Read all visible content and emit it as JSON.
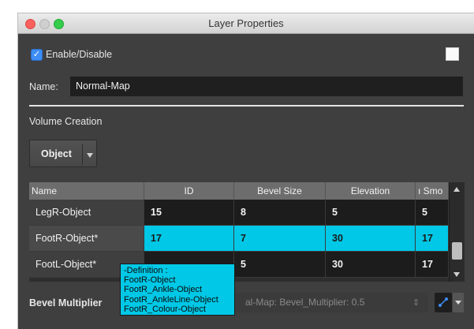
{
  "window": {
    "title": "Layer Properties"
  },
  "enable": {
    "label": "Enable/Disable",
    "checked": true
  },
  "name": {
    "label": "Name:",
    "value": "Normal-Map"
  },
  "volume": {
    "section_label": "Volume Creation",
    "dropdown_value": "Object"
  },
  "table": {
    "columns": [
      "Name",
      "ID",
      "Bevel Size",
      "Elevation",
      "ı Smo"
    ],
    "rows": [
      {
        "name": "LegR-Object",
        "id": "15",
        "bevel": "8",
        "elevation": "5",
        "smooth": "5"
      },
      {
        "name": "FootR-Object*",
        "id": "17",
        "bevel": "7",
        "elevation": "30",
        "smooth": "17"
      },
      {
        "name": "FootL-Object*",
        "id": "",
        "bevel": "5",
        "elevation": "30",
        "smooth": "17"
      }
    ]
  },
  "tooltip": {
    "lines": [
      "-Definition :",
      "FootR-Object",
      "FootR_Ankle-Object",
      "FootR_AnkleLine-Object",
      "FootR_Colour-Object"
    ]
  },
  "bevel": {
    "label": "Bevel Multiplier",
    "expression": "al-Map: Bevel_Multiplier: 0.5",
    "arrow": "⇕"
  },
  "colors": {
    "selection": "#00c8e6",
    "checkbox": "#3d8df5"
  }
}
